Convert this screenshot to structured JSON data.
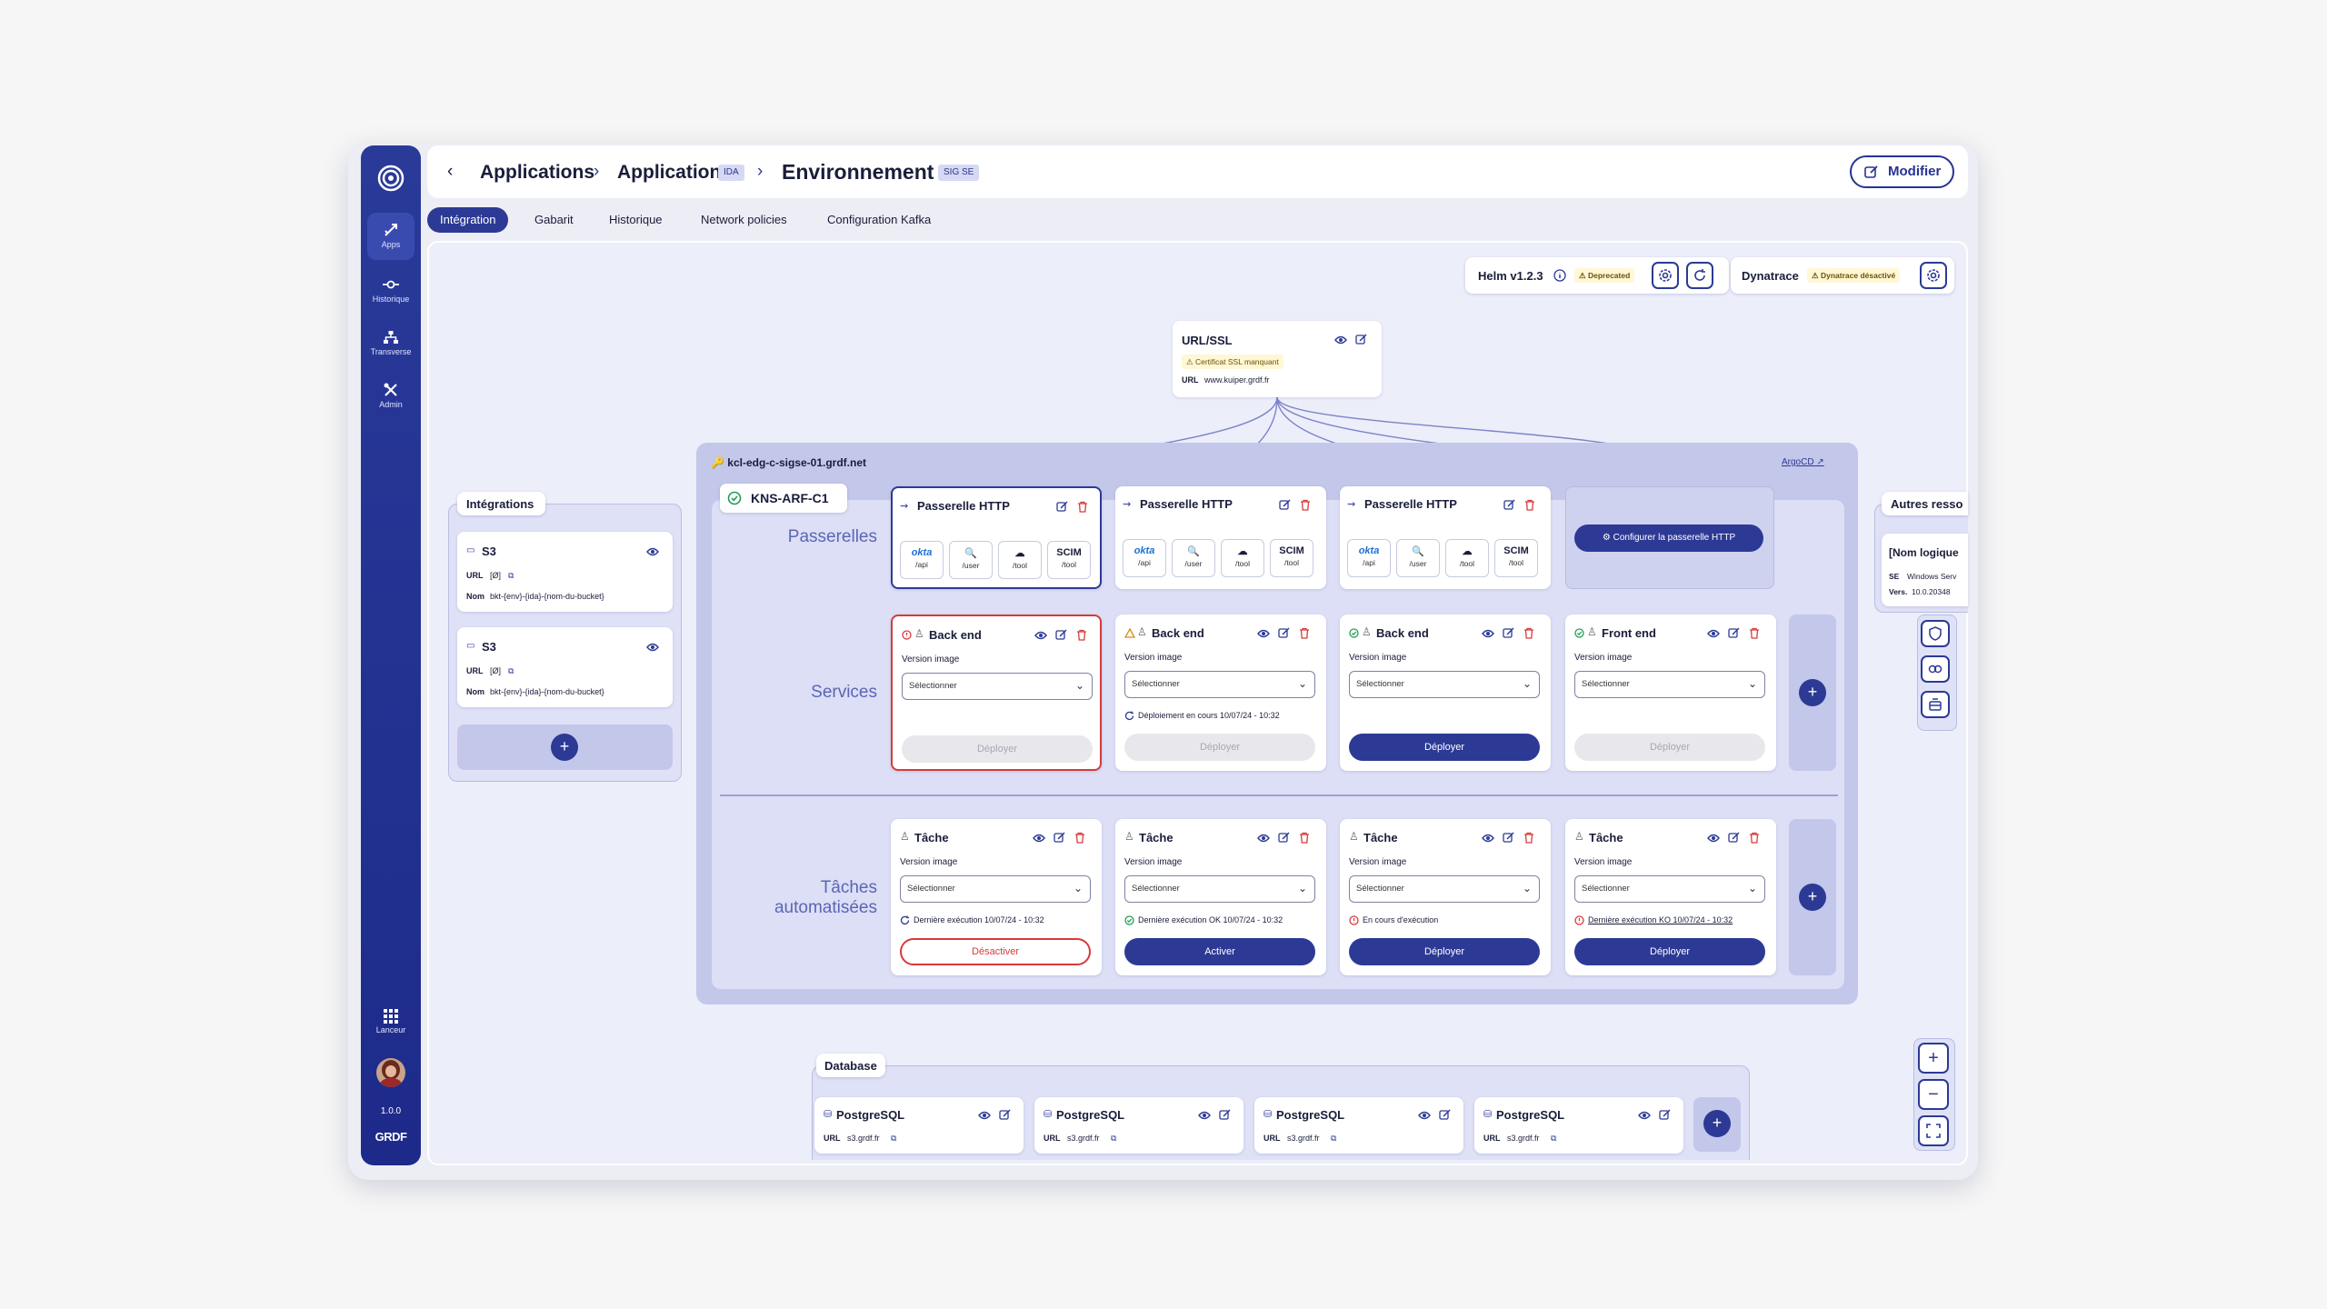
{
  "sidebar": {
    "items": [
      {
        "label": "Apps",
        "icon": "apps-icon",
        "active": true
      },
      {
        "label": "Historique",
        "icon": "history-icon",
        "active": false
      },
      {
        "label": "Transverse",
        "icon": "network-icon",
        "active": false
      },
      {
        "label": "Admin",
        "icon": "tools-icon",
        "active": false
      }
    ],
    "launcher_label": "Lanceur",
    "version": "1.0.0",
    "brand": "GRDF"
  },
  "header": {
    "crumb1": "Applications",
    "crumb2": "Application",
    "crumb2_tag": "IDA",
    "crumb3": "Environnement",
    "crumb3_tag": "SIG SE",
    "edit_label": "Modifier"
  },
  "tabs": [
    "Intégration",
    "Gabarit",
    "Historique",
    "Network policies",
    "Configuration Kafka"
  ],
  "helm": {
    "label": "Helm v1.2.3",
    "warning": "Deprecated"
  },
  "dynatrace": {
    "label": "Dynatrace",
    "warning": "Dynatrace désactivé"
  },
  "url_ssl": {
    "title": "URL/SSL",
    "warning": "Certificat SSL manquant",
    "url_key": "URL",
    "url_value": "www.kuiper.grdf.fr"
  },
  "cluster": {
    "host": "kcl-edg-c-sigse-01.grdf.net",
    "argocd": "ArgoCD",
    "namespace": "KNS-ARF-C1"
  },
  "sections": {
    "gateways": "Passerelles",
    "services": "Services",
    "tasks_line1": "Tâches",
    "tasks_line2": "automatisées"
  },
  "gateways": [
    {
      "title": "Passerelle HTTP",
      "items": [
        {
          "t": "okta",
          "s": "/api"
        },
        {
          "t": "🔍",
          "s": "/user"
        },
        {
          "t": "☁",
          "s": "/tool"
        },
        {
          "t": "SCIM",
          "s": "/tool"
        }
      ]
    },
    {
      "title": "Passerelle HTTP",
      "items": [
        {
          "t": "okta",
          "s": "/api"
        },
        {
          "t": "🔍",
          "s": "/user"
        },
        {
          "t": "☁",
          "s": "/tool"
        },
        {
          "t": "SCIM",
          "s": "/tool"
        }
      ]
    },
    {
      "title": "Passerelle HTTP",
      "items": [
        {
          "t": "okta",
          "s": "/api"
        },
        {
          "t": "🔍",
          "s": "/user"
        },
        {
          "t": "☁",
          "s": "/tool"
        },
        {
          "t": "SCIM",
          "s": "/tool"
        }
      ]
    }
  ],
  "configure_gateway": "Configurer la passerelle HTTP",
  "services": [
    {
      "title": "Back end",
      "version_label": "Version image",
      "select": "Sélectionner",
      "status": "",
      "button": "Déployer",
      "button_state": "disabled"
    },
    {
      "title": "Back end",
      "version_label": "Version image",
      "select": "Sélectionner",
      "status": "Déploiement en cours 10/07/24 - 10:32",
      "button": "Déployer",
      "button_state": "disabled"
    },
    {
      "title": "Back end",
      "version_label": "Version image",
      "select": "Sélectionner",
      "status": "",
      "button": "Déployer",
      "button_state": "primary"
    },
    {
      "title": "Front end",
      "version_label": "Version image",
      "select": "Sélectionner",
      "status": "",
      "button": "Déployer",
      "button_state": "disabled"
    }
  ],
  "tasks": [
    {
      "title": "Tâche",
      "version_label": "Version image",
      "select": "Sélectionner",
      "status": "Dernière exécution 10/07/24 - 10:32",
      "button": "Désactiver",
      "button_state": "danger"
    },
    {
      "title": "Tâche",
      "version_label": "Version image",
      "select": "Sélectionner",
      "status": "Dernière exécution OK 10/07/24 - 10:32",
      "button": "Activer",
      "button_state": "primary"
    },
    {
      "title": "Tâche",
      "version_label": "Version image",
      "select": "Sélectionner",
      "status": "En cours d'exécution",
      "button": "Déployer",
      "button_state": "primary"
    },
    {
      "title": "Tâche",
      "version_label": "Version image",
      "select": "Sélectionner",
      "status": "Dernière exécution KO 10/07/24 - 10:32",
      "button": "Déployer",
      "button_state": "primary"
    }
  ],
  "integrations": {
    "title": "Intégrations",
    "items": [
      {
        "title": "S3",
        "url_key": "URL",
        "url_value": "[Ø]",
        "name_key": "Nom",
        "name_value": "bkt-{env}-{ida}-{nom-du-bucket}"
      },
      {
        "title": "S3",
        "url_key": "URL",
        "url_value": "[Ø]",
        "name_key": "Nom",
        "name_value": "bkt-{env}-{ida}-{nom-du-bucket}"
      }
    ]
  },
  "other_resources": {
    "title": "Autres resso",
    "item_title": "[Nom logique",
    "se_key": "SE",
    "se_value": "Windows Serv",
    "vers_key": "Vers.",
    "vers_value": "10.0.20348"
  },
  "database": {
    "title": "Database",
    "items": [
      {
        "title": "PostgreSQL",
        "url_key": "URL",
        "url_value": "s3.grdf.fr"
      },
      {
        "title": "PostgreSQL",
        "url_key": "URL",
        "url_value": "s3.grdf.fr"
      },
      {
        "title": "PostgreSQL",
        "url_key": "URL",
        "url_value": "s3.grdf.fr"
      },
      {
        "title": "PostgreSQL",
        "url_key": "URL",
        "url_value": "s3.grdf.fr"
      }
    ]
  },
  "zoom": {
    "in": "+",
    "out": "−"
  }
}
